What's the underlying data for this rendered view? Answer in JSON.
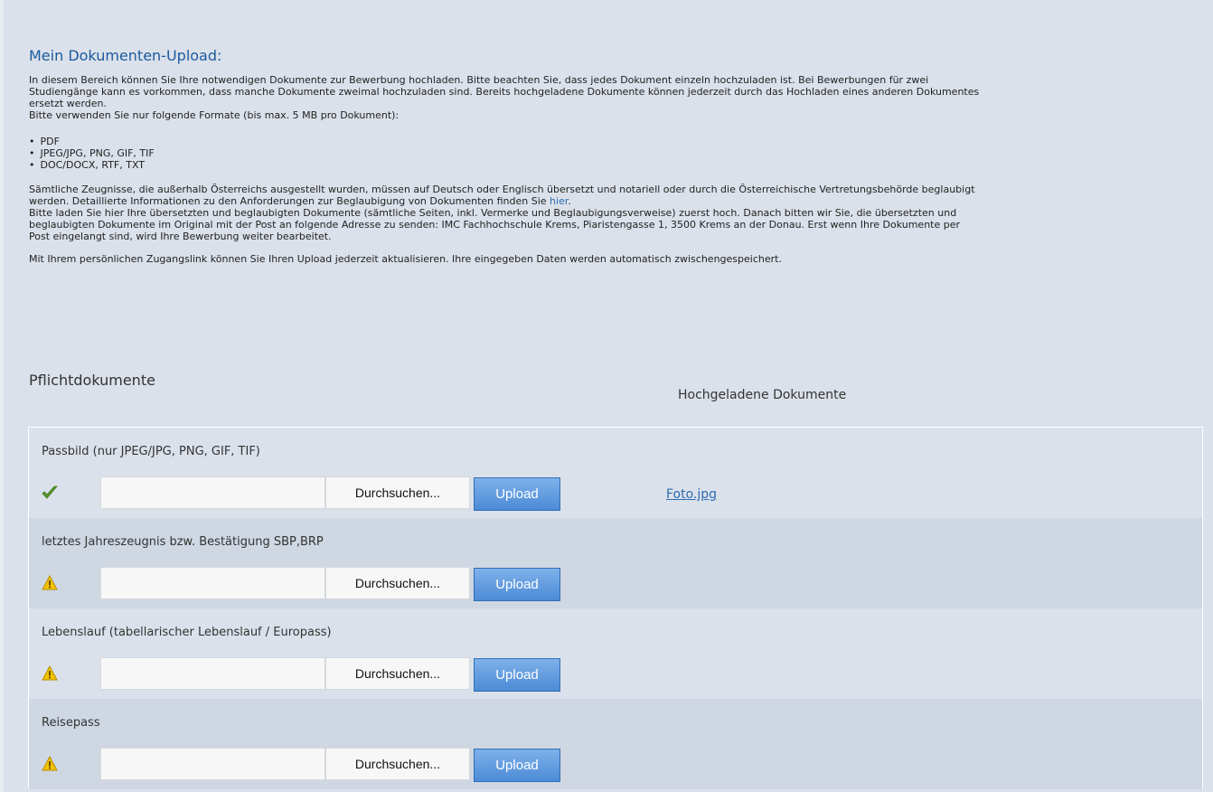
{
  "title": "Mein Dokumenten-Upload:",
  "intro": {
    "line1": "In diesem Bereich können Sie Ihre notwendigen Dokumente zur Bewerbung hochladen. Bitte beachten Sie, dass jedes Dokument einzeln hochzuladen ist. Bei Bewerbungen für zwei",
    "line2": "Studiengänge kann es vorkommen, dass manche Dokumente zweimal hochzuladen sind. Bereits hochgeladene Dokumente können jederzeit durch das Hochladen eines anderen Dokumentes",
    "line3": "ersetzt werden.",
    "line4": "Bitte verwenden Sie nur folgende Formate (bis max. 5 MB pro Dokument):"
  },
  "formats": [
    "PDF",
    "JPEG/JPG, PNG, GIF, TIF",
    "DOC/DOCX, RTF, TXT"
  ],
  "notes": {
    "line1": "Sämtliche Zeugnisse, die außerhalb Österreichs ausgestellt wurden, müssen auf Deutsch oder Englisch übersetzt und notariell oder durch die Österreichische Vertretungsbehörde beglaubigt",
    "line2_prefix": "werden. Detaillierte Informationen zu den Anforderungen zur Beglaubigung von Dokumenten finden Sie ",
    "line2_link": "hier",
    "line2_suffix": ".",
    "line3": "Bitte laden Sie hier Ihre übersetzten und beglaubigten Dokumente (sämtliche Seiten, inkl. Vermerke und Beglaubigungsverweise) zuerst hoch. Danach bitten wir Sie, die übersetzten und",
    "line4": "beglaubigten Dokumente im Original mit der Post an folgende Adresse zu senden: IMC Fachhochschule Krems, Piaristengasse 1, 3500 Krems an der Donau. Erst wenn Ihre Dokumente per",
    "line5": "Post eingelangt sind, wird Ihre Bewerbung weiter bearbeitet.",
    "line6": "Mit Ihrem persönlichen Zugangslink können Sie Ihren Upload jederzeit aktualisieren. Ihre eingegeben Daten werden automatisch zwischengespeichert."
  },
  "section": {
    "heading": "Pflichtdokumente",
    "uploaded_heading": "Hochgeladene Dokumente"
  },
  "buttons": {
    "browse": "Durchsuchen...",
    "upload": "Upload"
  },
  "documents": [
    {
      "label": "Passbild (nur JPEG/JPG, PNG, GIF, TIF)",
      "status": "check-icon",
      "uploaded": "Foto.jpg"
    },
    {
      "label": "letztes Jahreszeugnis bzw. Bestätigung SBP,BRP",
      "status": "warning-icon",
      "uploaded": ""
    },
    {
      "label": "Lebenslauf (tabellarischer Lebenslauf / Europass)",
      "status": "warning-icon",
      "uploaded": ""
    },
    {
      "label": "Reisepass",
      "status": "warning-icon",
      "uploaded": ""
    }
  ],
  "colors": {
    "background": "#dbe1ea",
    "row_alt": "#cfd7e2",
    "title": "#1c5a9e",
    "link": "#2f6cb3",
    "upload_button": "#4c8bd6",
    "check": "#5a9a2e",
    "warning": "#f2c200"
  }
}
